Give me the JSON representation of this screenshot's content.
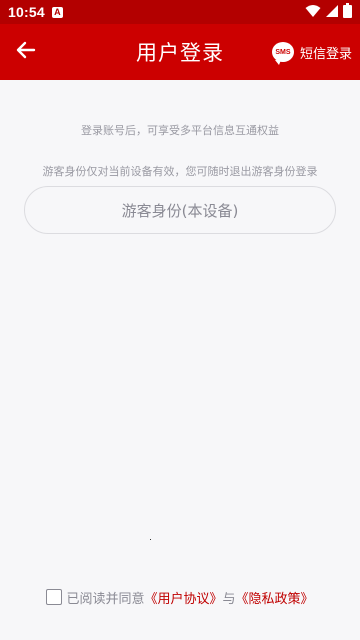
{
  "status_bar": {
    "time": "10:54",
    "notification_icon": "A"
  },
  "app_bar": {
    "title": "用户登录",
    "sms_icon_text": "SMS",
    "sms_label": "短信登录",
    "background": "#cc0000"
  },
  "content": {
    "info_line_1": "登录账号后，可享受多平台信息互通权益",
    "info_line_2": "游客身份仅对当前设备有效，您可随时退出游客身份登录",
    "guest_button_label": "游客身份(本设备)"
  },
  "agreement": {
    "prefix": "已阅读并同意",
    "user_agreement": "《用户协议》",
    "connector": "与",
    "privacy_policy": "《隐私政策》",
    "checked": false
  },
  "icons": {
    "back": "arrow-left-icon",
    "wifi": "wifi-icon",
    "signal": "signal-icon",
    "battery": "battery-icon",
    "sms": "sms-bubble-icon"
  }
}
